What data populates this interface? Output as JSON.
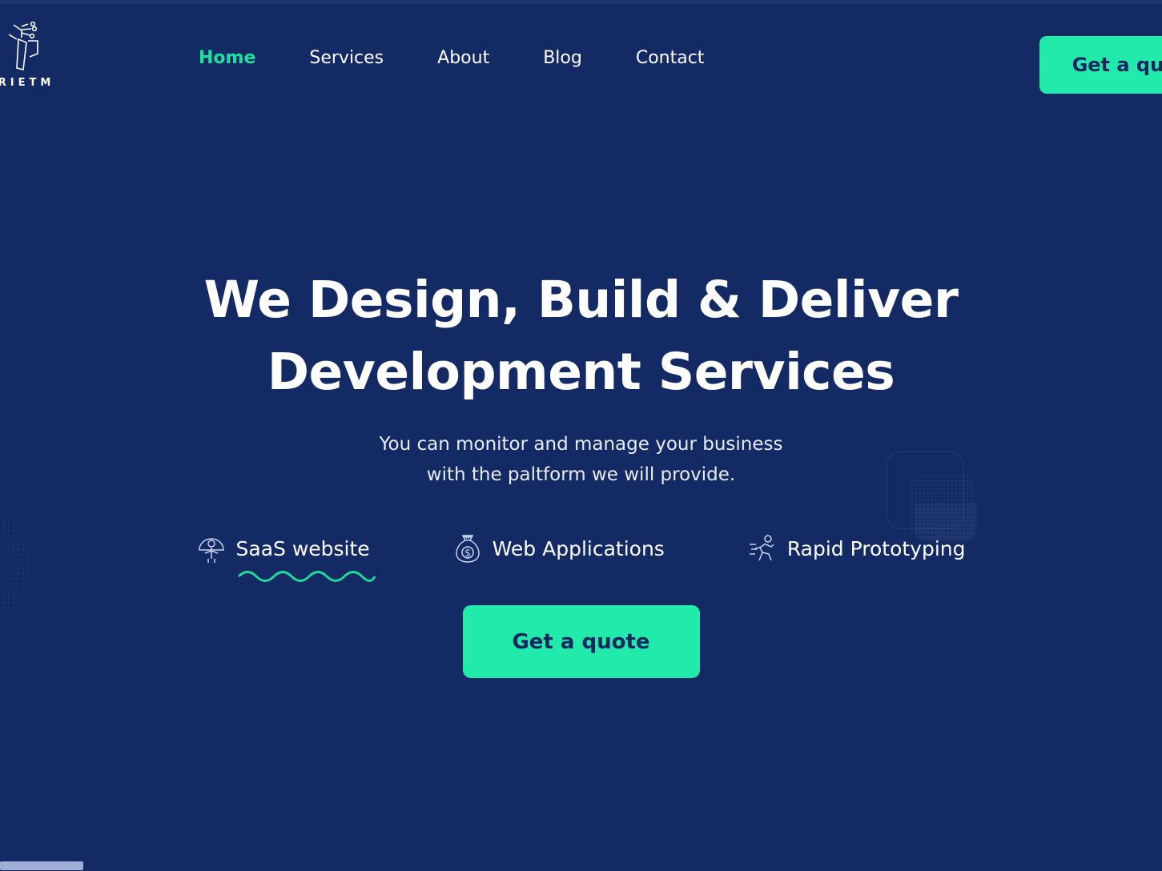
{
  "theme": {
    "background": "#132a64",
    "accent": "#22eaaa",
    "accent_nav": "#1fe0a0",
    "text_light": "#ffffff",
    "text_dark": "#13265f"
  },
  "header": {
    "logo": {
      "wordmark": "RIETM",
      "icon": "circuit-person-logo-icon"
    },
    "nav_items": [
      {
        "label": "Home",
        "active": true
      },
      {
        "label": "Services",
        "active": false
      },
      {
        "label": "About",
        "active": false
      },
      {
        "label": "Blog",
        "active": false
      },
      {
        "label": "Contact",
        "active": false
      }
    ],
    "cta_label": "Get a quote"
  },
  "hero": {
    "title_line1": "We Design, Build & Deliver",
    "title_line2": "Development Services",
    "subtitle_line1": "You can monitor and manage your business",
    "subtitle_line2": "with the paltform we will provide.",
    "cta_label": "Get a quote",
    "features": [
      {
        "label": "SaaS website",
        "icon": "saas-person-dome-icon",
        "underlined": true
      },
      {
        "label": "Web Applications",
        "icon": "money-bag-icon",
        "underlined": false
      },
      {
        "label": "Rapid Prototyping",
        "icon": "running-person-icon",
        "underlined": false
      }
    ]
  },
  "chrome": {
    "horizontal_scrollbar": "horizontal-scrollbar"
  }
}
